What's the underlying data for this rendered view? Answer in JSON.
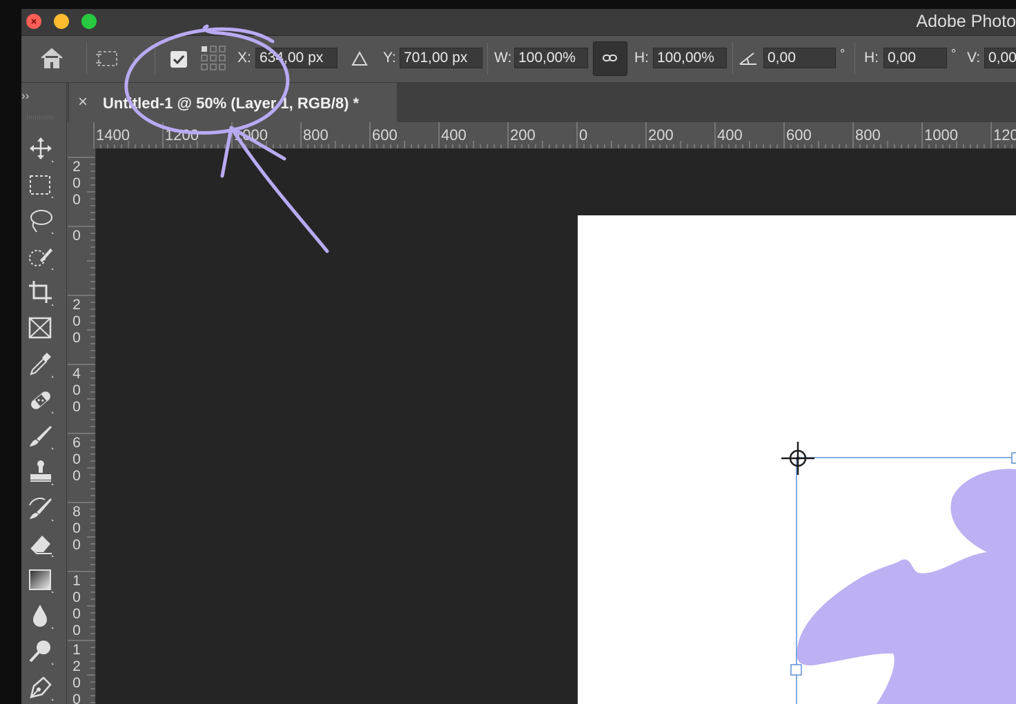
{
  "window": {
    "app_title": "Adobe Photo"
  },
  "options_bar": {
    "x_label": "X:",
    "x_value": "634,00 px",
    "delta_icon": "triangle-delta-icon",
    "y_label": "Y:",
    "y_value": "701,00 px",
    "w_label": "W:",
    "w_value": "100,00%",
    "h_label": "H:",
    "h_value": "100,00%",
    "angle_value": "0,00",
    "degree_symbol": "°",
    "skew_h_label": "H:",
    "skew_h_value": "0,00",
    "degree_symbol_2": "°",
    "skew_v_label": "V:",
    "skew_v_value": "0,00"
  },
  "panel_toggle": "››",
  "document_tab": {
    "close_glyph": "×",
    "title": "Untitled-1 @ 50% (Layer 1, RGB/8) *"
  },
  "h_ruler": [
    "1400",
    "1200",
    "1000",
    "800",
    "600",
    "400",
    "200",
    "0",
    "200",
    "400",
    "600",
    "800",
    "1000",
    "120"
  ],
  "v_ruler": [
    "200",
    "0",
    "200",
    "400",
    "600",
    "800",
    "1000",
    "1200"
  ],
  "tools": [
    "move-tool",
    "marquee-tool",
    "lasso-tool",
    "quick-selection-tool",
    "crop-tool",
    "frame-tool",
    "eyedropper-tool",
    "healing-brush-tool",
    "brush-tool",
    "clone-stamp-tool",
    "history-brush-tool",
    "eraser-tool",
    "gradient-tool",
    "blur-tool",
    "dodge-tool",
    "pen-tool"
  ],
  "colors": {
    "annotation": "#b9aaf3",
    "shape_fill": "#bdb0f3",
    "selection": "#5b8fd6"
  }
}
